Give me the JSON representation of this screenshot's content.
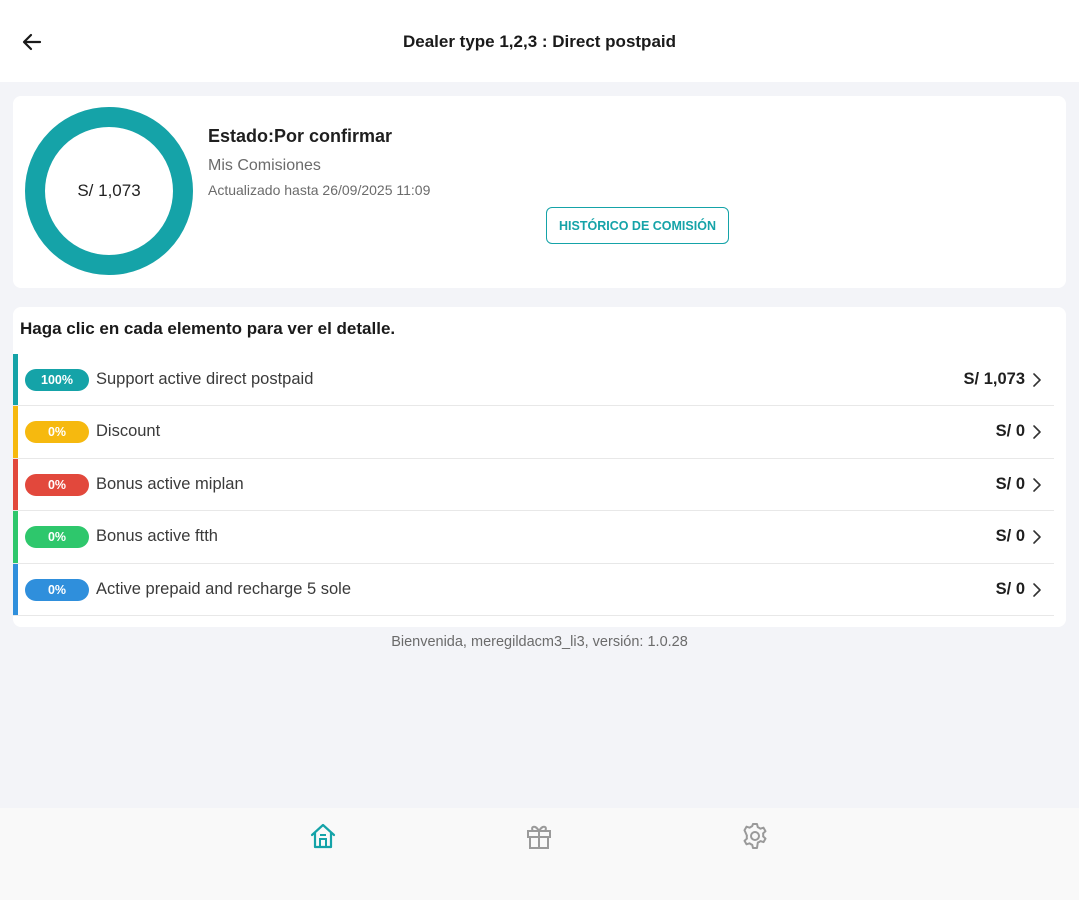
{
  "appbar": {
    "title": "Dealer type 1,2,3 : Direct postpaid"
  },
  "summary": {
    "amount": "S/ 1,073",
    "status": "Estado:Por confirmar",
    "subtitle": "Mis Comisiones",
    "updated": "Actualizado hasta 26/09/2025 11:09",
    "history_button": "HISTÓRICO DE COMISIÓN",
    "donut_color": "#15a3a8",
    "donut_fill_percent": 100
  },
  "detail": {
    "heading": "Haga clic en cada elemento para ver el detalle.",
    "items": [
      {
        "percent": "100%",
        "label": "Support active direct postpaid",
        "amount": "S/ 1,073",
        "color": "#15a3a8"
      },
      {
        "percent": "0%",
        "label": "Discount",
        "amount": "S/ 0",
        "color": "#f6b90f"
      },
      {
        "percent": "0%",
        "label": "Bonus active miplan",
        "amount": "S/ 0",
        "color": "#e2483c"
      },
      {
        "percent": "0%",
        "label": "Bonus active ftth",
        "amount": "S/ 0",
        "color": "#2ec76c"
      },
      {
        "percent": "0%",
        "label": "Active prepaid and recharge 5 sole",
        "amount": "S/ 0",
        "color": "#2f8fdc"
      }
    ]
  },
  "footer": {
    "text": "Bienvenida, meregildacm3_li3, versión: 1.0.28"
  },
  "bottom_nav": {
    "items": [
      {
        "icon": "home-icon",
        "active": true
      },
      {
        "icon": "gift-icon",
        "active": false
      },
      {
        "icon": "gear-icon",
        "active": false
      }
    ],
    "active_color": "#15a3a8",
    "inactive_color": "#9a9a9a"
  }
}
